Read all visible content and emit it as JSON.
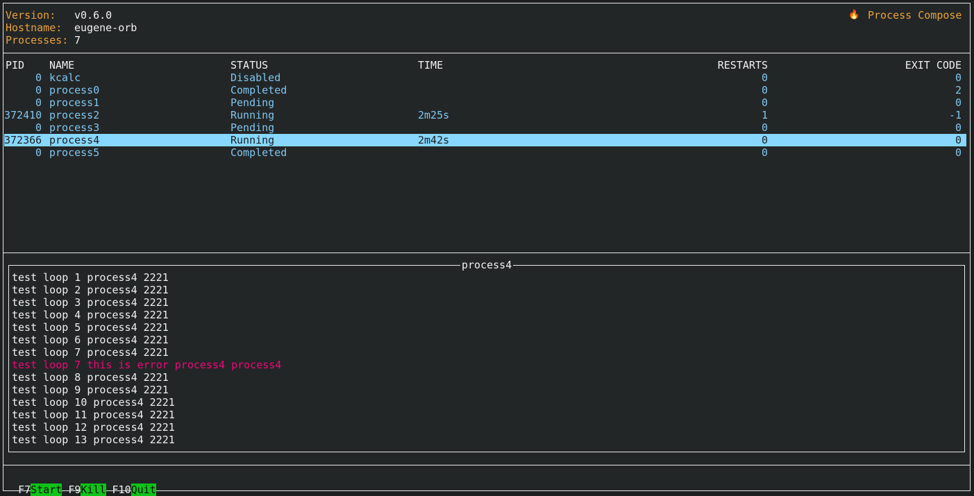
{
  "header": {
    "version_label": "Version:",
    "version": "v0.6.0",
    "hostname_label": "Hostname:",
    "hostname": "eugene-orb",
    "processes_label": "Processes:",
    "processes": "7",
    "app_title": "Process Compose",
    "app_icon": "fire-icon"
  },
  "table": {
    "columns": [
      "PID",
      "NAME",
      "STATUS",
      "TIME",
      "RESTARTS",
      "EXIT CODE"
    ],
    "selected_index": 5,
    "rows": [
      {
        "pid": "0",
        "name": "kcalc",
        "status": "Disabled",
        "time": "",
        "restarts": "0",
        "exit": "0"
      },
      {
        "pid": "0",
        "name": "process0",
        "status": "Completed",
        "time": "",
        "restarts": "0",
        "exit": "2"
      },
      {
        "pid": "0",
        "name": "process1",
        "status": "Pending",
        "time": "",
        "restarts": "0",
        "exit": "0"
      },
      {
        "pid": "372410",
        "name": "process2",
        "status": "Running",
        "time": "2m25s",
        "restarts": "1",
        "exit": "-1"
      },
      {
        "pid": "0",
        "name": "process3",
        "status": "Pending",
        "time": "",
        "restarts": "0",
        "exit": "0"
      },
      {
        "pid": "372366",
        "name": "process4",
        "status": "Running",
        "time": "2m42s",
        "restarts": "0",
        "exit": "0"
      },
      {
        "pid": "0",
        "name": "process5",
        "status": "Completed",
        "time": "",
        "restarts": "0",
        "exit": "0"
      }
    ]
  },
  "log": {
    "title": "process4",
    "lines": [
      {
        "text": "test loop 1 process4 2221",
        "error": false
      },
      {
        "text": "test loop 2 process4 2221",
        "error": false
      },
      {
        "text": "test loop 3 process4 2221",
        "error": false
      },
      {
        "text": "test loop 4 process4 2221",
        "error": false
      },
      {
        "text": "test loop 5 process4 2221",
        "error": false
      },
      {
        "text": "test loop 6 process4 2221",
        "error": false
      },
      {
        "text": "test loop 7 process4 2221",
        "error": false
      },
      {
        "text": "test loop 7 this is error process4 process4",
        "error": true
      },
      {
        "text": "test loop 8 process4 2221",
        "error": false
      },
      {
        "text": "test loop 9 process4 2221",
        "error": false
      },
      {
        "text": "test loop 10 process4 2221",
        "error": false
      },
      {
        "text": "test loop 11 process4 2221",
        "error": false
      },
      {
        "text": "test loop 12 process4 2221",
        "error": false
      },
      {
        "text": "test loop 13 process4 2221",
        "error": false
      }
    ]
  },
  "footer": {
    "actions": [
      {
        "key": "F7",
        "label": "Start"
      },
      {
        "key": "F9",
        "label": "Kill"
      },
      {
        "key": "F10",
        "label": "Quit"
      }
    ]
  },
  "colors": {
    "background": "#232627",
    "header_label": "#e8a23c",
    "table_text": "#7fc6ee",
    "selection": "#87d7ff",
    "error_text": "#f0077a",
    "footer_action": "#0fc418"
  }
}
